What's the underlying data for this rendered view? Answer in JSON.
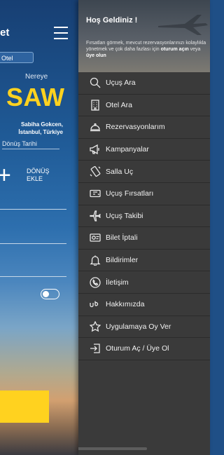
{
  "background_app": {
    "logo_fragment": "et",
    "tab_label": "Otel",
    "destination_label": "Nereye",
    "destination_code": "SAW",
    "destination_airport": "Sabiha Gokcen,",
    "destination_city": "İstanbul, Türkiye",
    "return_date_label": "Dönüş Tarihi",
    "return_add_plus": "+",
    "return_add_line1": "DÖNÜŞ",
    "return_add_line2": "EKLE"
  },
  "drawer": {
    "welcome": "Hoş Geldiniz !",
    "intro_text": "Fırsatları görmek, mevcut rezervasyonlarınızı kolaylıkla yönetmek ve çok daha fazlası için",
    "intro_login": "oturum açın",
    "intro_or": "veya",
    "intro_signup": "üye olun",
    "items": [
      {
        "label": "Uçuş Ara",
        "icon": "search-icon"
      },
      {
        "label": "Otel Ara",
        "icon": "building-icon"
      },
      {
        "label": "Rezervasyonlarım",
        "icon": "cloche-icon"
      },
      {
        "label": "Kampanyalar",
        "icon": "megaphone-icon"
      },
      {
        "label": "Salla Uç",
        "icon": "shake-phone-icon"
      },
      {
        "label": "Uçuş Fırsatları",
        "icon": "ticket-icon"
      },
      {
        "label": "Uçuş Takibi",
        "icon": "plane-icon"
      },
      {
        "label": "Bilet İptali",
        "icon": "ticket-cancel-icon"
      },
      {
        "label": "Bildirimler",
        "icon": "bell-icon"
      },
      {
        "label": "İletişim",
        "icon": "phone-icon"
      },
      {
        "label": "Hakkımızda",
        "icon": "brand-icon"
      },
      {
        "label": "Uygulamaya Oy Ver",
        "icon": "star-icon"
      },
      {
        "label": "Oturum Aç / Üye Ol",
        "icon": "login-icon"
      }
    ]
  }
}
